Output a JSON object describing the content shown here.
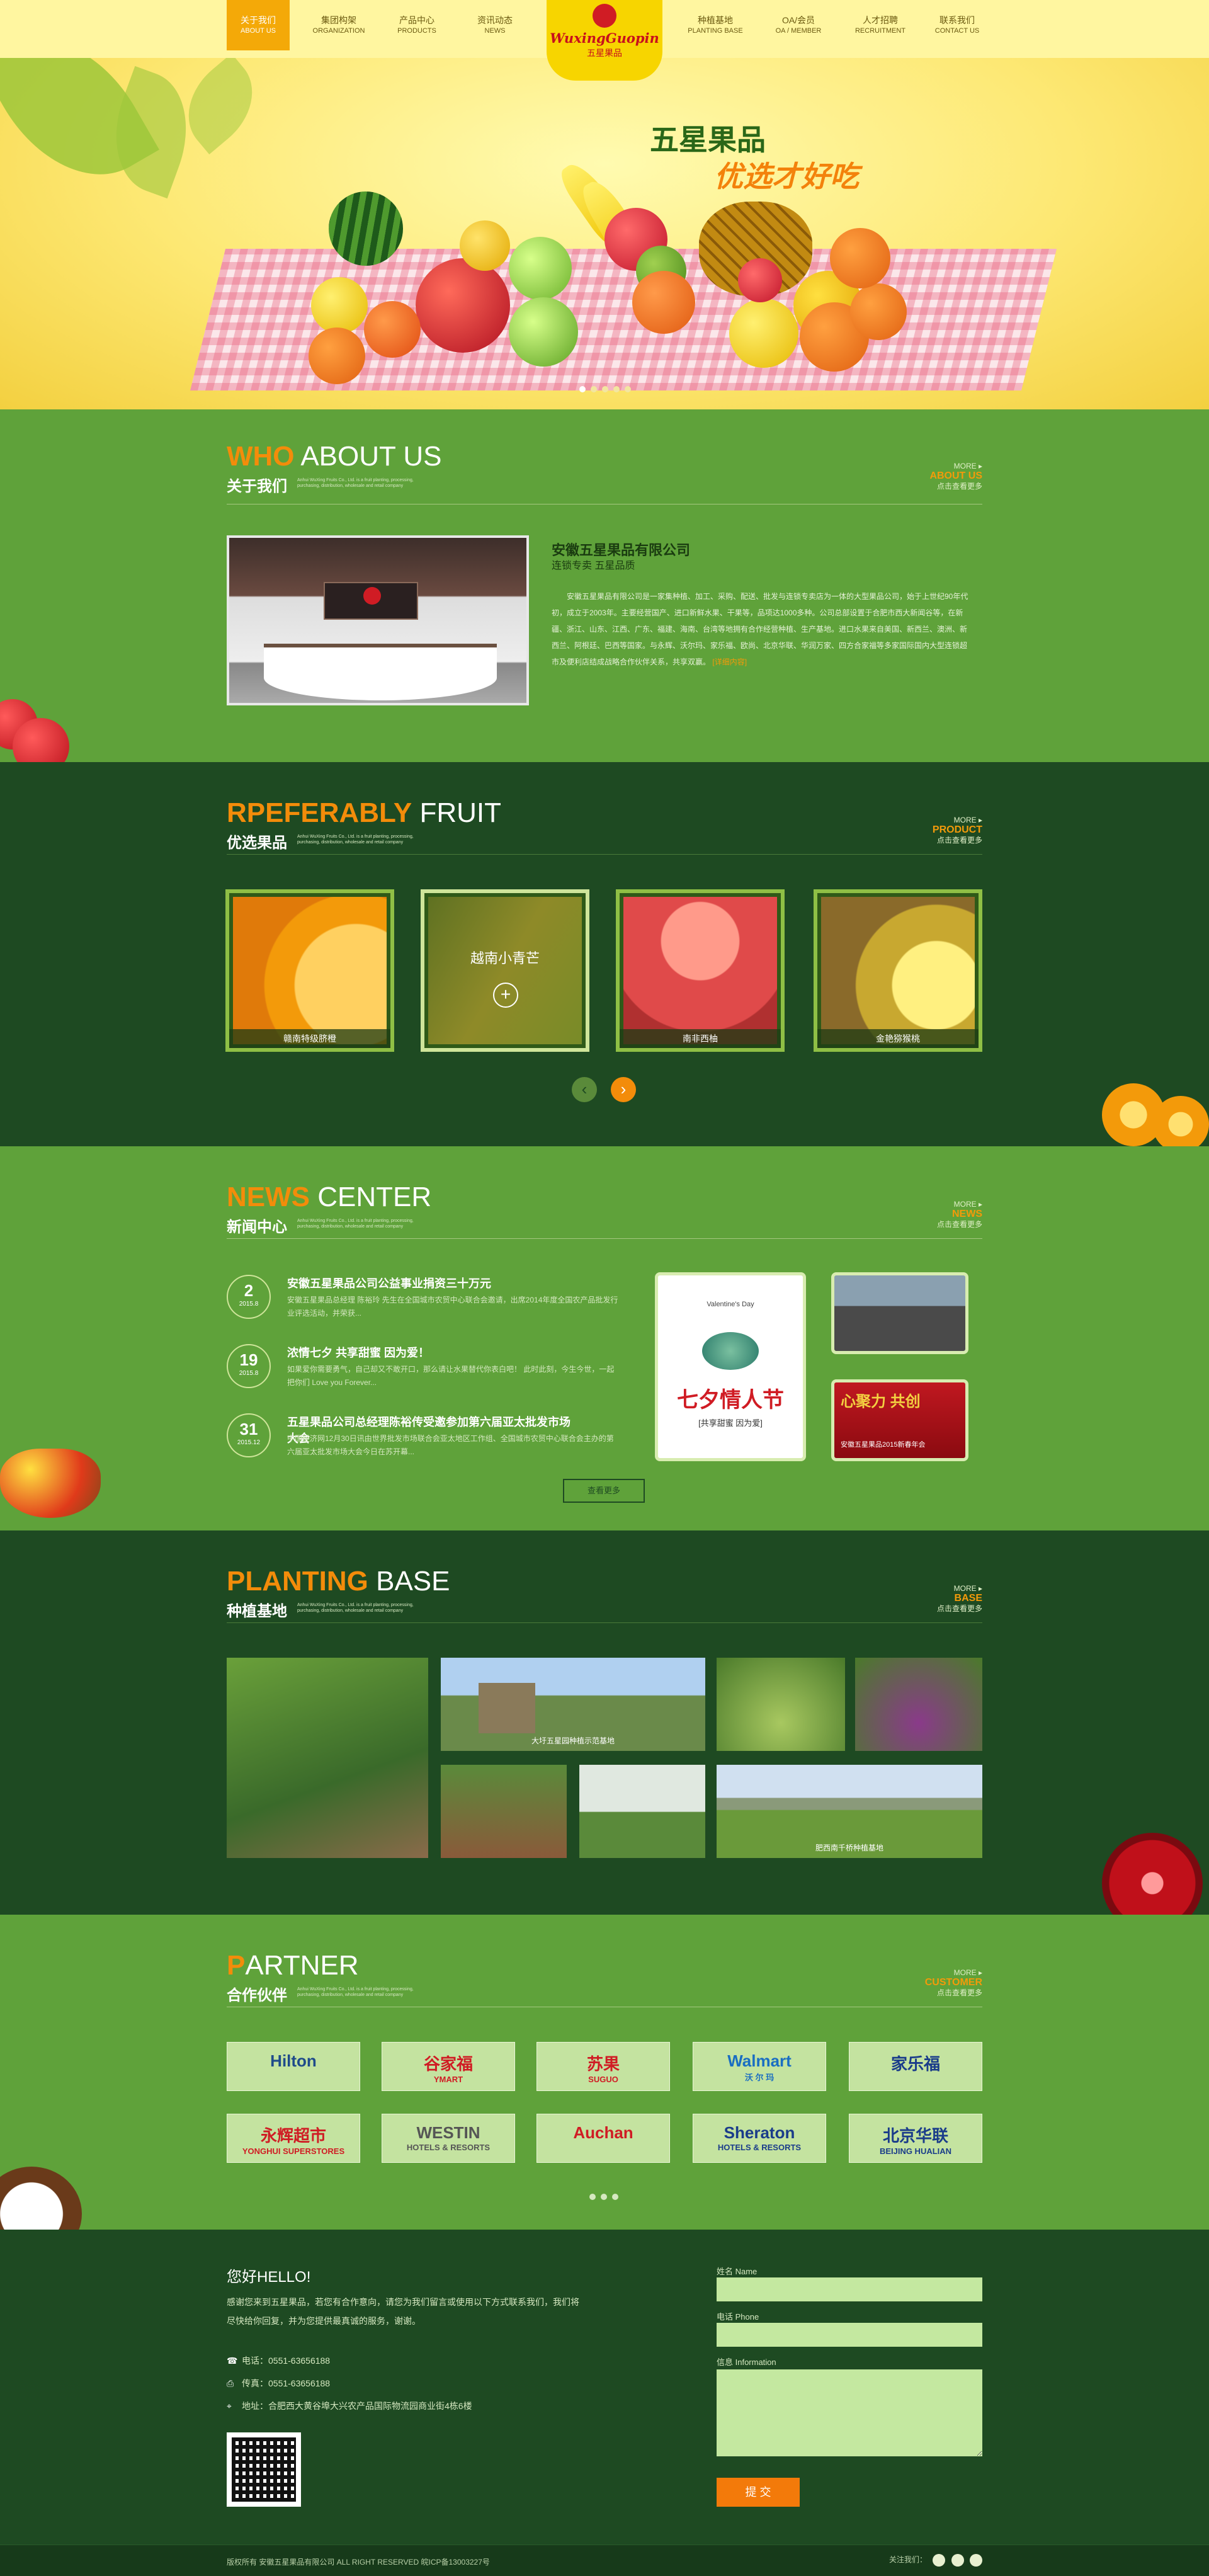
{
  "nav": {
    "left": [
      {
        "cn": "关于我们",
        "en": "ABOUT US",
        "active": true
      },
      {
        "cn": "集团构架",
        "en": "ORGANIZATION"
      },
      {
        "cn": "产品中心",
        "en": "PRODUCTS"
      },
      {
        "cn": "资讯动态",
        "en": "NEWS"
      }
    ],
    "right": [
      {
        "cn": "种植基地",
        "en": "PLANTING BASE"
      },
      {
        "cn": "OA/会员",
        "en": "OA / MEMBER"
      },
      {
        "cn": "人才招聘",
        "en": "RECRUITMENT"
      },
      {
        "cn": "联系我们",
        "en": "CONTACT US"
      }
    ],
    "logo_en": "WuxingGuopin",
    "logo_cn": "五星果品"
  },
  "hero": {
    "slogan1": "五星果品",
    "slogan2": "优选才好吃"
  },
  "about": {
    "title_en1": "WHO",
    "title_en2": " ABOUT US",
    "title_cn": "关于我们",
    "tagline": "Anhui WuXing Fruits Co., Ltd. is a fruit planting, processing, purchasing, distribution, wholesale and retail company",
    "more": "MORE ▸",
    "more_en": "ABOUT US",
    "more_cn": "点击查看更多",
    "company": "安徽五星果品有限公司",
    "sub": "连锁专卖 五星品质",
    "body": "安徽五星果品有限公司是一家集种植、加工、采购、配送、批发与连锁专卖店为一体的大型果品公司，始于上世纪90年代初，成立于2003年。主要经营国产、进口新鲜水果、干果等，品项达1000多种。公司总部设置于合肥市西大新闻谷等，在新疆、浙江、山东、江西、广东、福建、海南、台湾等地拥有合作经营种植、生产基地。进口水果来自美国、新西兰、澳洲、新西兰、阿根廷、巴西等国家。与永辉、沃尔玛、家乐福、欧尚、北京华联、华润万家、四方合家福等多家国际国内大型连锁超市及便利店结成战略合作伙伴关系，共享双赢。",
    "detail": "[详细内容]"
  },
  "products": {
    "title_en1": "RPEFERABLY",
    "title_en2": " FRUIT",
    "title_cn": "优选果品",
    "tagline": "Anhui WuXing Fruits Co., Ltd. is a fruit planting, processing, purchasing, distribution, wholesale and retail company",
    "more": "MORE ▸",
    "more_en": "PRODUCT",
    "more_cn": "点击查看更多",
    "items": [
      {
        "name": "赣南特级脐橙"
      },
      {
        "name": "越南小青芒"
      },
      {
        "name": "南非西柚"
      },
      {
        "name": "金艳猕猴桃"
      }
    ],
    "prev": "‹",
    "next": "›"
  },
  "news": {
    "title_en1": "NEWS",
    "title_en2": " CENTER",
    "title_cn": "新闻中心",
    "tagline": "Anhui WuXing Fruits Co., Ltd. is a fruit planting, processing, purchasing, distribution, wholesale and retail company",
    "more": "MORE ▸",
    "more_en": "NEWS",
    "more_cn": "点击查看更多",
    "items": [
      {
        "day": "2",
        "ym": "2015.8",
        "title": "安徽五星果品公司公益事业捐资三十万元",
        "text": "安徽五星果品总经理 陈裕玲 先生在全国城市农贸中心联合会邀请，出席2014年度全国农产品批发行业评选活动，并荣获..."
      },
      {
        "day": "19",
        "ym": "2015.8",
        "title": "浓情七夕 共享甜蜜 因为爱！",
        "text": "如果爱你需要勇气，自己却又不敢开口，那么请让水果替代你表白吧！ 此时此刻，今生今世，一起把你们 Love you Forever..."
      },
      {
        "day": "31",
        "ym": "2015.12",
        "title": "五星果品公司总经理陈裕传受邀参加第六届亚太批发市场大会",
        "text": "中国经济网12月30日讯由世界批发市场联合会亚太地区工作组、全国城市农贸中心联合会主办的第六届亚太批发市场大会今日在苏开幕..."
      }
    ],
    "more_btn": "查看更多",
    "poster_title": "七夕情人节",
    "poster_sub": "[共享甜蜜 因为爱]",
    "poster_en": "Valentine's Day",
    "banner_text": "安徽五星果品2015新春年会",
    "banner_slogan": "心聚力 共创"
  },
  "planting": {
    "title_en1": "PLANTING",
    "title_en2": " BASE",
    "title_cn": "种植基地",
    "tagline": "Anhui WuXing Fruits Co., Ltd. is a fruit planting, processing, purchasing, distribution, wholesale and retail company",
    "more": "MORE ▸",
    "more_en": "BASE",
    "more_cn": "点击查看更多",
    "captions": {
      "house": "大圩五星园种植示范基地",
      "vineyard": "肥西南千桥种植基地"
    }
  },
  "partners": {
    "title_en1": "P",
    "title_en2": "ARTNER",
    "title_cn": "合作伙伴",
    "tagline": "Anhui WuXing Fruits Co., Ltd. is a fruit planting, processing, purchasing, distribution, wholesale and retail company",
    "more": "MORE ▸",
    "more_en": "CUSTOMER",
    "more_cn": "点击查看更多",
    "items": [
      {
        "l1": "Hilton",
        "l2": "",
        "color": "#1f4b8a"
      },
      {
        "l1": "谷家福",
        "l2": "YMART",
        "color": "#d01c24"
      },
      {
        "l1": "苏果",
        "l2": "SUGUO",
        "color": "#d01c24"
      },
      {
        "l1": "Walmart",
        "l2": "沃 尔 玛",
        "color": "#1a6ec2"
      },
      {
        "l1": "家乐福",
        "l2": "",
        "color": "#1a3c8a"
      },
      {
        "l1": "永辉超市",
        "l2": "YONGHUI SUPERSTORES",
        "color": "#d01c24"
      },
      {
        "l1": "WESTIN",
        "l2": "HOTELS & RESORTS",
        "color": "#555555"
      },
      {
        "l1": "Auchan",
        "l2": "",
        "color": "#d01c24"
      },
      {
        "l1": "Sheraton",
        "l2": "HOTELS & RESORTS",
        "color": "#1a3c8a"
      },
      {
        "l1": "北京华联",
        "l2": "BEIJING HUALIAN",
        "color": "#1a3c8a"
      }
    ]
  },
  "footer": {
    "hello": "您好HELLO!",
    "text": "感谢您来到五星果品，若您有合作意向，请您为我们留言或使用以下方式联系我们，我们将尽快给你回复，并为您提供最真诚的服务，谢谢。",
    "phone": "电话：0551-63656188",
    "fax": "传真：0551-63656188",
    "addr": "地址：合肥西大黄谷埠大兴农产品国际物流园商业街4栋6楼",
    "name_label": "姓名 Name",
    "phone_label": "电话 Phone",
    "info_label": "信息 Information",
    "submit": "提 交",
    "copyright": "版权所有 安徽五星果品有限公司 ALL RIGHT RESERVED   皖ICP备13003227号",
    "follow": "关注我们："
  }
}
